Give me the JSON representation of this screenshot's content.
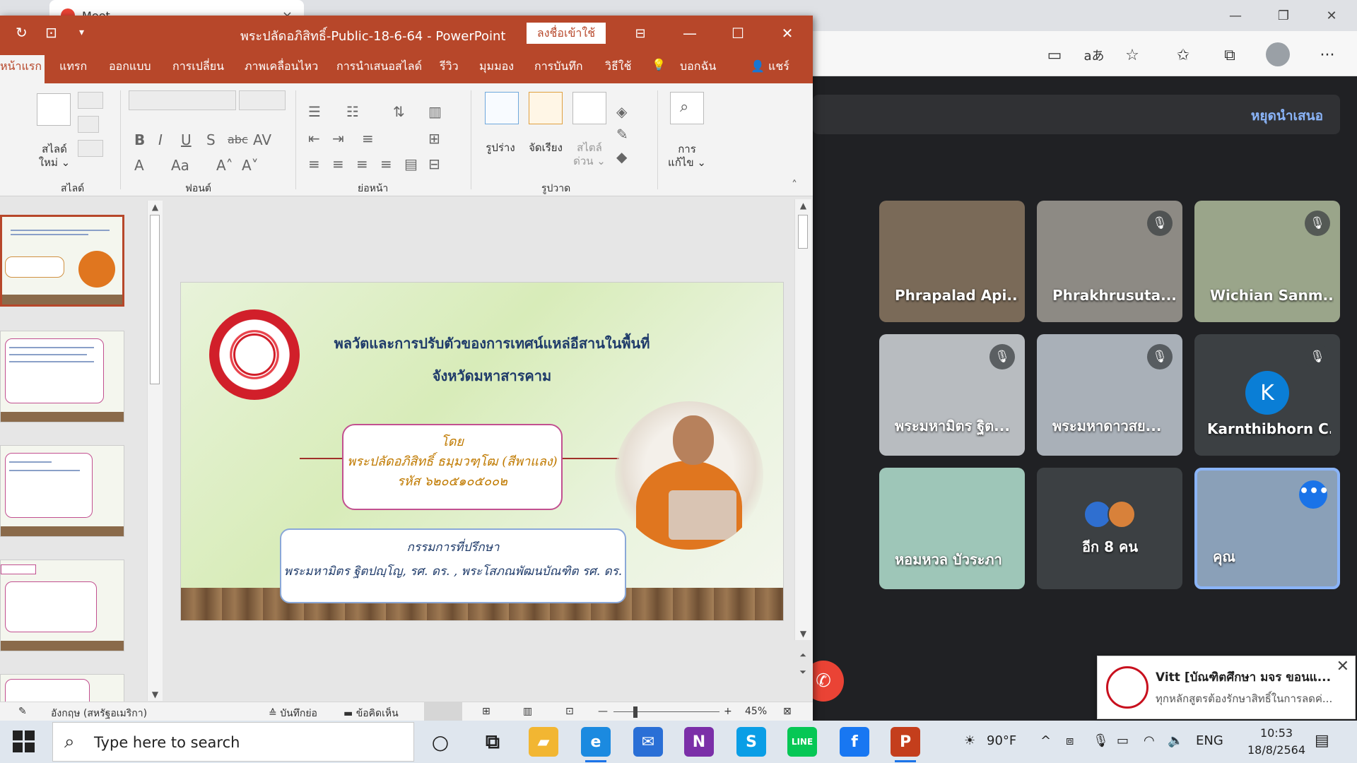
{
  "browser": {
    "tab_title": "Meet – ...",
    "tab_close": "×",
    "window": {
      "minimize": "—",
      "restore": "❐",
      "close": "✕"
    },
    "toolbar_icons": {
      "camera": "▭",
      "translate": "aあ",
      "add_fav": "☆",
      "favorites": "✩",
      "collections": "⧉",
      "menu": "···"
    }
  },
  "meet": {
    "stop_presenting": "หยุดนำเสนอ",
    "tiles": [
      {
        "name": "Phrapalad Api...",
        "muted": false,
        "bg": "#7a6a58"
      },
      {
        "name": "Phrakhrusuta...",
        "muted": true,
        "bg": "#8d8a84"
      },
      {
        "name": "Wichian Sanm...",
        "muted": true,
        "bg": "#9aa58a"
      },
      {
        "name": "พระมหามิตร ฐิต...",
        "muted": true,
        "bg": "#b8bcc0"
      },
      {
        "name": "พระมหาดาวสย...",
        "muted": true,
        "bg": "#a9b0b8"
      },
      {
        "name": "Karnthibhorn C...",
        "muted": true,
        "bg": "#3c4043",
        "avatar_letter": "K"
      },
      {
        "name": "หอมหวล บัวระภา",
        "muted": false,
        "bg": "#9ec6b8"
      },
      {
        "name": "อีก 8 คน",
        "muted": false,
        "bg": "#3c4043"
      },
      {
        "name": "คุณ",
        "muted": false,
        "bg": "#8aa0b8"
      }
    ],
    "mute_glyph": "🎙",
    "more_glyph": "•••",
    "end_call_glyph": "✆"
  },
  "toast": {
    "title": "Vitt [บัณฑิตศึกษา มจร ขอนแ...",
    "body": "ทุกหลักสูตรต้องรักษาสิทธิ์ในการลดค่...",
    "close": "✕"
  },
  "ppt": {
    "title": "พระปลัดอภิสิทธิ์-Public-18-6-64  -  PowerPoint",
    "signin": "ลงชื่อเข้าใช้",
    "window": {
      "minimize": "—",
      "maximize": "☐",
      "close": "✕"
    },
    "qat": {
      "redo": "↻",
      "present": "⊡",
      "more": "▾"
    },
    "tabs": [
      "หน้าแรก",
      "แทรก",
      "ออกแบบ",
      "การเปลี่ยน",
      "ภาพเคลื่อนไหว",
      "การนำเสนอสไลด์",
      "รีวิว",
      "มุมมอง",
      "การบันทึก",
      "วิธีใช้",
      "บอกฉัน",
      "แชร์"
    ],
    "ribbon": {
      "new_slide_line1": "สไลด์",
      "new_slide_line2": "ใหม่ ⌄",
      "group_slide": "สไลด์",
      "group_font": "ฟอนต์",
      "group_paragraph": "ย่อหน้า",
      "group_drawing": "รูปวาด",
      "shapes": "รูปร่าง",
      "arrange": "จัดเรียง",
      "quick_styles_line1": "สไตล์",
      "quick_styles_line2": "ด่วน ⌄",
      "editing_line1": "การ",
      "editing_line2": "แก้ไข ⌄",
      "font_glyphs": {
        "bold": "B",
        "italic": "I",
        "underline": "U",
        "strike": "S",
        "abc": "abc",
        "spacing": "AV",
        "font_color": "A",
        "case": "Aa",
        "grow": "A˄",
        "shrink": "A˅"
      }
    },
    "slide": {
      "title_line1": "พลวัตและการปรับตัวของการเทศน์แหล่อีสานในพื้นที่",
      "title_line2": "จังหวัดมหาสารคาม",
      "by": "โดย",
      "author": "พระปลัดอภิสิทธิ์ ธมฺมวฑฺโฒ (สีพาแลง)",
      "student_id": "รหัส ๖๒๐๕๑๐๕๐๐๒",
      "advisor_heading": "กรรมการที่ปรึกษา",
      "advisors": "พระมหามิตร ฐิตปญฺโญ, รศ. ดร. , พระโสภณพัฒนบัณฑิต รศ. ดร."
    },
    "statusbar": {
      "language": "อังกฤษ (สหรัฐอเมริกา)",
      "notes": "บันทึกย่อ",
      "comments": "ข้อคิดเห็น",
      "zoom_minus": "—",
      "zoom_plus": "+",
      "zoom": "45%"
    }
  },
  "taskbar": {
    "search_placeholder": "Type here to search",
    "apps": [
      {
        "name": "cortana",
        "glyph": "○",
        "color": "transparent"
      },
      {
        "name": "task-view",
        "glyph": "⧉",
        "color": "transparent"
      },
      {
        "name": "file-explorer",
        "glyph": "▰",
        "color": "#f2b632"
      },
      {
        "name": "edge",
        "glyph": "e",
        "color": "#1b8ae0"
      },
      {
        "name": "mail",
        "glyph": "✉",
        "color": "#2a6fd6"
      },
      {
        "name": "onenote",
        "glyph": "N",
        "color": "#7b2fa8"
      },
      {
        "name": "skype",
        "glyph": "S",
        "color": "#0a9ee6"
      },
      {
        "name": "line",
        "glyph": "LINE",
        "color": "#06c755"
      },
      {
        "name": "facebook",
        "glyph": "f",
        "color": "#1877f2"
      },
      {
        "name": "powerpoint",
        "glyph": "P",
        "color": "#c43e1c"
      }
    ],
    "weather": "90°F",
    "tray_up": "^",
    "lang": "ENG",
    "time": "10:53",
    "date": "18/8/2564",
    "notifications_glyph": "▤"
  }
}
